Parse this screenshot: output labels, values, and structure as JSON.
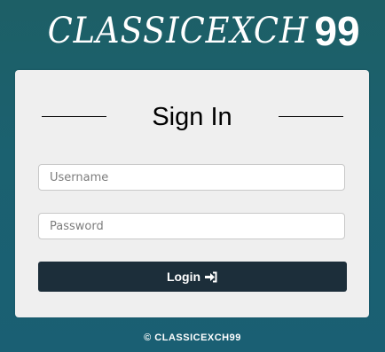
{
  "brand": {
    "script_text": "CLASSICEXCH",
    "number_text": "99"
  },
  "login_card": {
    "title": "Sign In",
    "username_placeholder": "Username",
    "password_placeholder": "Password",
    "login_label": "Login",
    "login_icon": "sign-in-icon"
  },
  "footer": {
    "copyright": "© CLASSICEXCH99"
  },
  "colors": {
    "background": "#1b6170",
    "card": "#efefef",
    "button": "#1c2e3a",
    "text_light": "#ffffff"
  }
}
